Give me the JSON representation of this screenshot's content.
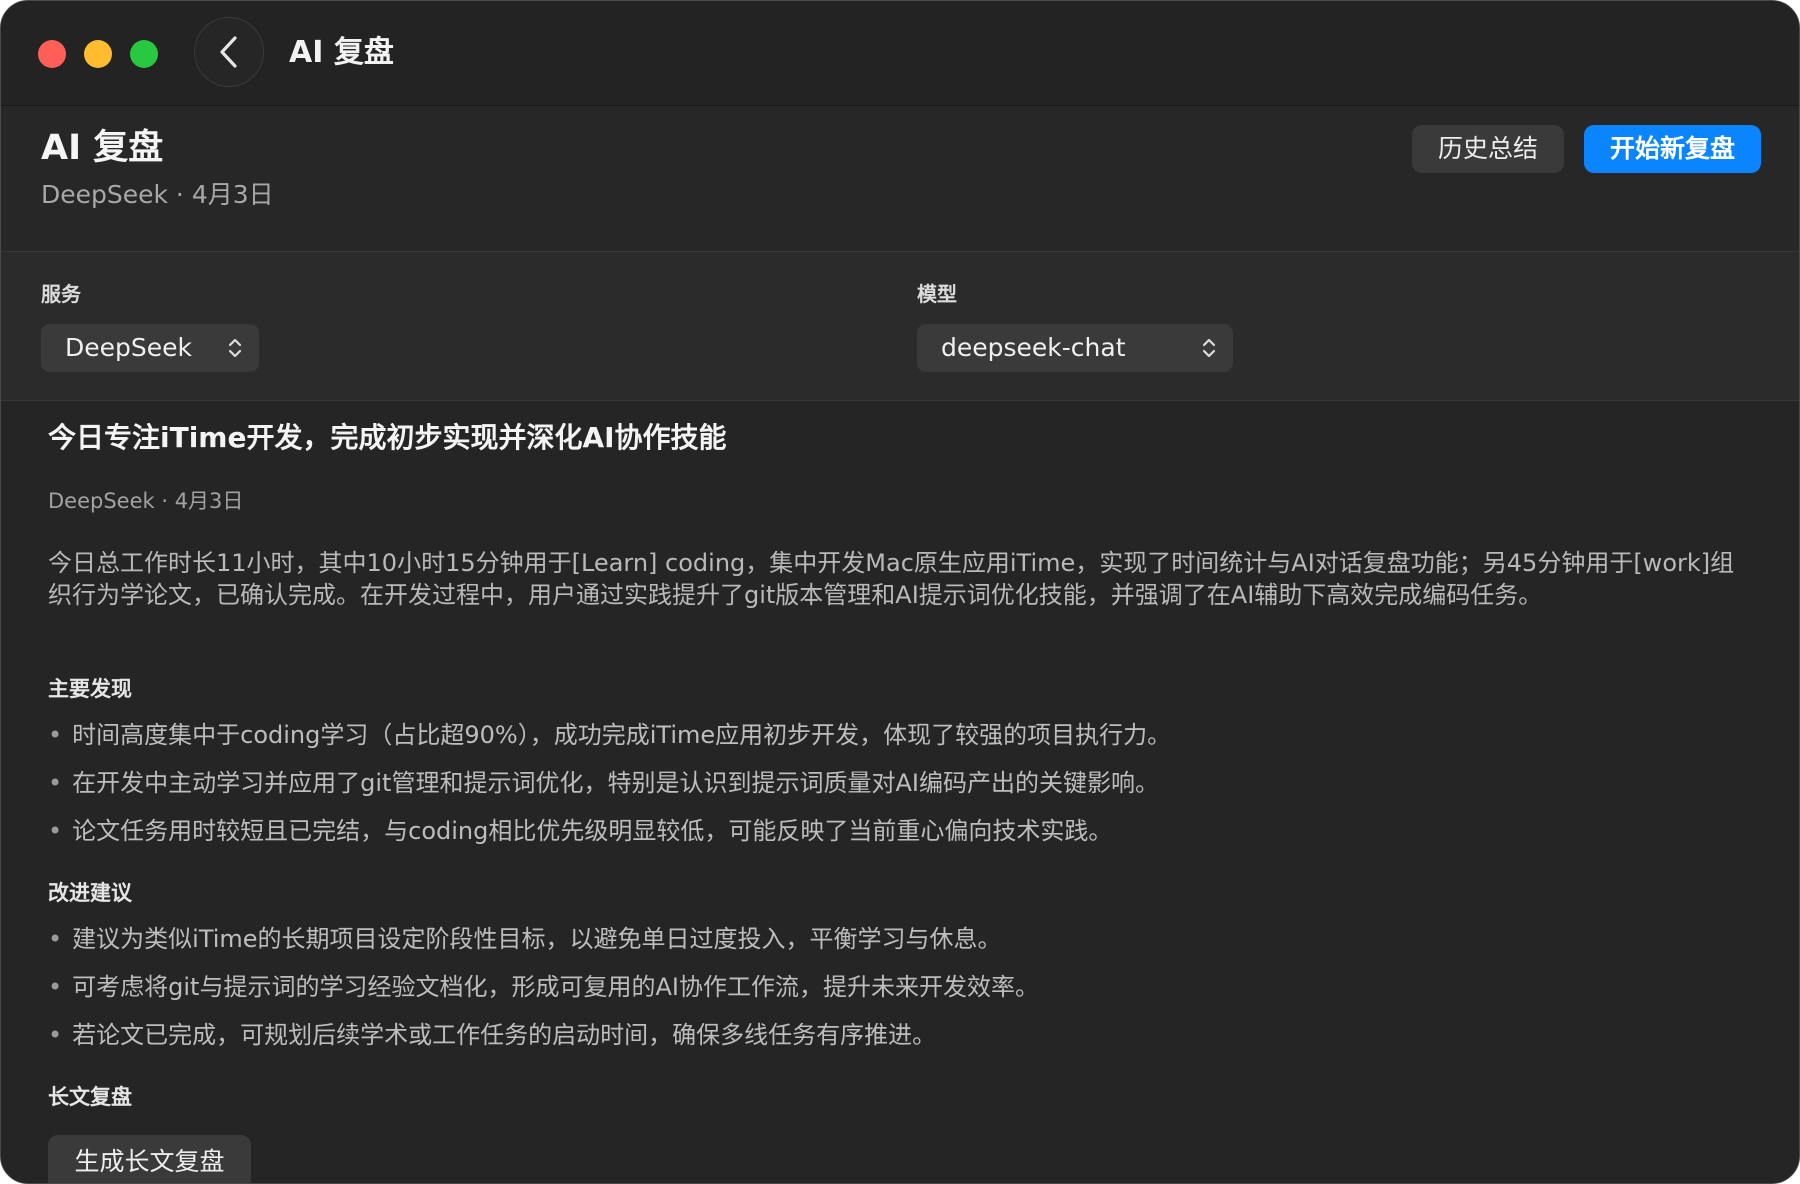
{
  "window": {
    "title": "AI 复盘"
  },
  "header": {
    "title": "AI 复盘",
    "subtitle": "DeepSeek · 4月3日",
    "history_button": "历史总结",
    "new_button": "开始新复盘"
  },
  "selectors": {
    "service_label": "服务",
    "service_value": "DeepSeek",
    "model_label": "模型",
    "model_value": "deepseek-chat"
  },
  "summary": {
    "title": "今日专注iTime开发，完成初步实现并深化AI协作技能",
    "meta": "DeepSeek · 4月3日",
    "body": "今日总工作时长11小时，其中10小时15分钟用于[Learn] coding，集中开发Mac原生应用iTime，实现了时间统计与AI对话复盘功能；另45分钟用于[work]组织行为学论文，已确认完成。在开发过程中，用户通过实践提升了git版本管理和AI提示词优化技能，并强调了在AI辅助下高效完成编码任务。",
    "findings_heading": "主要发现",
    "findings": [
      "时间高度集中于coding学习（占比超90%），成功完成iTime应用初步开发，体现了较强的项目执行力。",
      "在开发中主动学习并应用了git管理和提示词优化，特别是认识到提示词质量对AI编码产出的关键影响。",
      "论文任务用时较短且已完结，与coding相比优先级明显较低，可能反映了当前重心偏向技术实践。"
    ],
    "suggestions_heading": "改进建议",
    "suggestions": [
      "建议为类似iTime的长期项目设定阶段性目标，以避免单日过度投入，平衡学习与休息。",
      "可考虑将git与提示词的学习经验文档化，形成可复用的AI协作工作流，提升未来开发效率。",
      "若论文已完成，可规划后续学术或工作任务的启动时间，确保多线任务有序推进。"
    ],
    "long_heading": "长文复盘",
    "long_button": "生成长文复盘"
  },
  "colors": {
    "accent": "#0a84ff",
    "background": "#252525",
    "close": "#ff5f57",
    "minimize": "#febc2e",
    "zoom": "#28c840"
  },
  "icons": {
    "back": "chevron-left-icon",
    "select": "chevron-up-down-icon"
  }
}
